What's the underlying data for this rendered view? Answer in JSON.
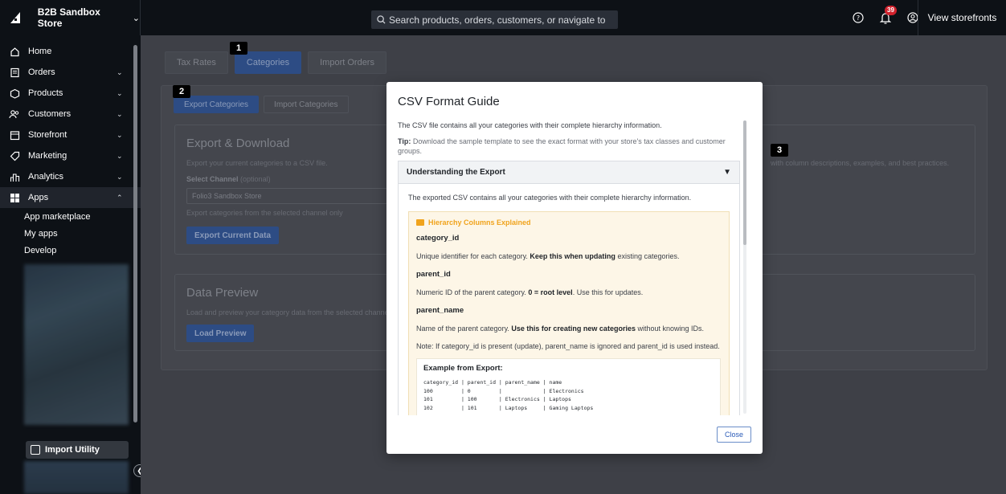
{
  "topbar": {
    "store_name": "B2B Sandbox Store",
    "search_placeholder": "Search products, orders, customers, or navigate to",
    "notification_count": "39",
    "view_storefronts": "View storefronts"
  },
  "sidebar": {
    "items": [
      {
        "label": "Home",
        "icon": "home-icon"
      },
      {
        "label": "Orders",
        "icon": "orders-icon"
      },
      {
        "label": "Products",
        "icon": "products-icon"
      },
      {
        "label": "Customers",
        "icon": "customers-icon"
      },
      {
        "label": "Storefront",
        "icon": "storefront-icon"
      },
      {
        "label": "Marketing",
        "icon": "marketing-icon"
      },
      {
        "label": "Analytics",
        "icon": "analytics-icon"
      },
      {
        "label": "Apps",
        "icon": "apps-icon"
      }
    ],
    "apps_sub": [
      "App marketplace",
      "My apps",
      "Develop"
    ],
    "partial_label": "Folio3",
    "import_utility": "Import Utility"
  },
  "main": {
    "tabs": [
      "Tax Rates",
      "Categories",
      "Import Orders"
    ],
    "subtabs": [
      "Export Categories",
      "Import Categories"
    ],
    "export": {
      "title": "Export & Download",
      "desc": "Export your current categories to a CSV file.",
      "channel_label": "Select Channel",
      "channel_optional": "(optional)",
      "channel_value": "Folio3 Sandbox Store",
      "channel_hint": "Export categories from the selected channel only",
      "button": "Export Current Data"
    },
    "guide_hint": "with column descriptions, examples, and best practices.",
    "preview": {
      "title": "Data Preview",
      "desc": "Load and preview your category data from the selected channel",
      "button": "Load Preview"
    },
    "markers": [
      "1",
      "2",
      "3"
    ]
  },
  "modal": {
    "title": "CSV Format Guide",
    "intro": "The CSV file contains all your categories with their complete hierarchy information.",
    "tip_label": "Tip:",
    "tip_text": "Download the sample template to see the exact format with your store's tax classes and customer groups.",
    "accordion_title": "Understanding the Export",
    "accordion_intro": "The exported CSV contains all your categories with their complete hierarchy information.",
    "hierarchy_title": "Hierarchy Columns Explained",
    "columns": [
      {
        "name": "category_id",
        "pre": "Unique identifier for each category. ",
        "bold": "Keep this when updating",
        "post": " existing categories."
      },
      {
        "name": "parent_id",
        "pre": "Numeric ID of the parent category. ",
        "bold": "0 = root level",
        "post": ". Use this for updates."
      },
      {
        "name": "parent_name",
        "pre": "Name of the parent category. ",
        "bold": "Use this for creating new categories",
        "post": " without knowing IDs."
      }
    ],
    "note": "Note: If category_id is present (update), parent_name is ignored and parent_id is used instead.",
    "example_title": "Example from Export:",
    "example_lines": [
      "category_id | parent_id | parent_name | name",
      "100         | 0         |             | Electronics",
      "101         | 100       | Electronics | Laptops",
      "102         | 101       | Laptops     | Gaming Laptops"
    ],
    "close": "Close"
  }
}
